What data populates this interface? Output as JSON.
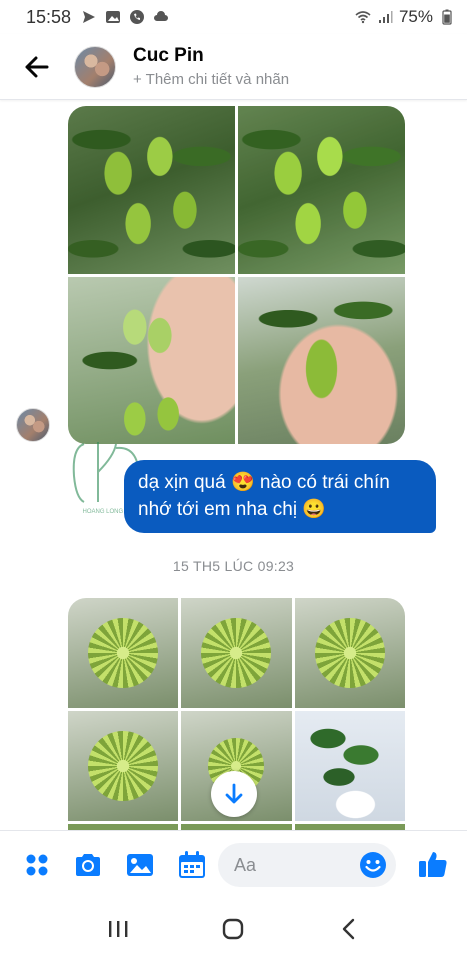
{
  "status_bar": {
    "time": "15:58",
    "battery": "75%"
  },
  "header": {
    "contact_name": "Cuc Pin",
    "subtitle": "+ Thêm chi tiết và nhãn"
  },
  "messages": {
    "outgoing_text": "dạ xịn quá 😍 nào có trái chín nhớ tới em nha chị 😀",
    "timestamp": "15 TH5 LÚC 09:23"
  },
  "watermark": {
    "text": "HOANG LONG GA"
  },
  "composer": {
    "placeholder": "Aa"
  },
  "colors": {
    "accent": "#0a7cff",
    "bubble": "#0a5bbf"
  },
  "icons": {
    "back": "arrow-left-icon",
    "menu": "four-dots-icon",
    "camera": "camera-icon",
    "gallery": "image-icon",
    "calendar": "calendar-icon",
    "emoji": "emoji-icon",
    "like": "thumbs-up-icon",
    "scroll_down": "arrow-down-icon"
  }
}
